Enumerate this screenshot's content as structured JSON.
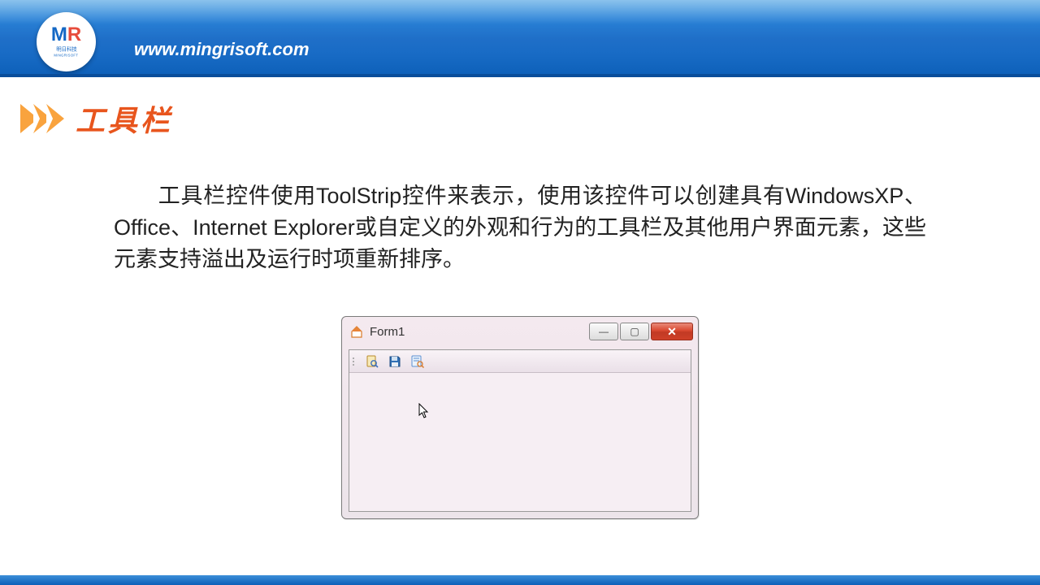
{
  "header": {
    "logo_top": "MR",
    "logo_mid": "明日科技",
    "logo_bottom": "MINGRISOFT",
    "url": "www.mingrisoft.com"
  },
  "title": "工具栏",
  "body": "工具栏控件使用ToolStrip控件来表示，使用该控件可以创建具有WindowsXP、Office、Internet Explorer或自定义的外观和行为的工具栏及其他用户界面元素，这些元素支持溢出及运行时项重新排序。",
  "window": {
    "title": "Form1",
    "buttons": {
      "min": "—",
      "max": "▢",
      "close": "✕"
    },
    "toolstrip_icons": [
      "search-document-icon",
      "save-icon",
      "page-search-icon"
    ]
  }
}
